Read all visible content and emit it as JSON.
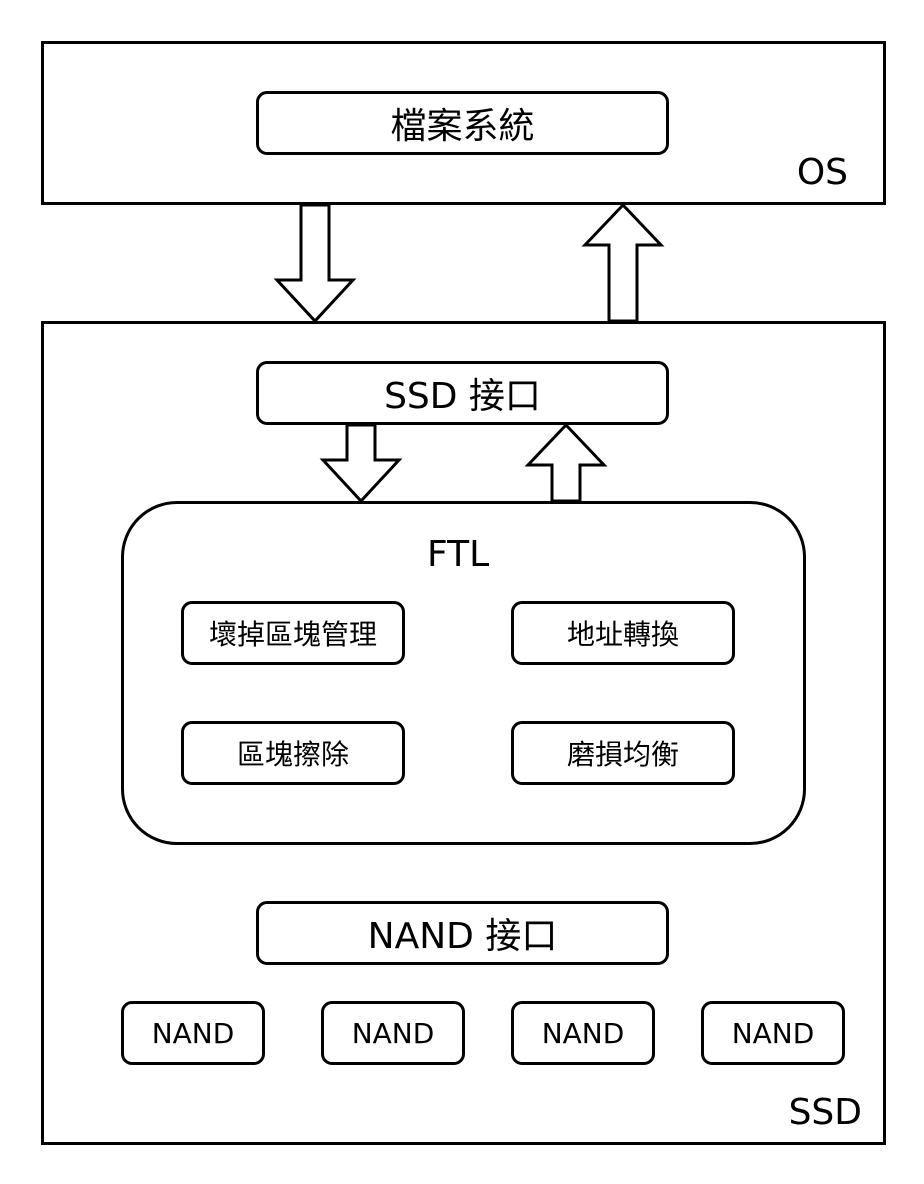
{
  "os": {
    "label": "OS",
    "file_system": "檔案系統"
  },
  "ssd": {
    "label": "SSD",
    "interface": "SSD 接口",
    "ftl": {
      "title": "FTL",
      "bad_block_management": "壞掉區塊管理",
      "address_translation": "地址轉換",
      "block_erase": "區塊擦除",
      "wear_leveling": "磨損均衡"
    },
    "nand_interface": "NAND 接口",
    "nand_chips": [
      "NAND",
      "NAND",
      "NAND",
      "NAND"
    ]
  },
  "colors": {
    "stroke": "#000000",
    "fill": "#ffffff"
  }
}
